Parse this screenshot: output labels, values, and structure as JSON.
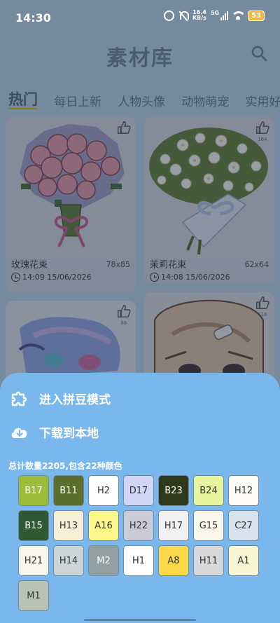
{
  "status_bar": {
    "time": "14:30",
    "network_speed_value": "16.4",
    "network_speed_unit": "KB/s",
    "network_type": "5G",
    "battery": "53",
    "icons": [
      "alarm-icon",
      "mute-icon",
      "signal-icon",
      "wifi-icon",
      "battery-icon"
    ]
  },
  "header": {
    "title": "素材库",
    "search_icon": "search-icon"
  },
  "tabs": [
    {
      "label": "热门",
      "active": true
    },
    {
      "label": "每日上新",
      "active": false
    },
    {
      "label": "人物头像",
      "active": false
    },
    {
      "label": "动物萌宠",
      "active": false
    },
    {
      "label": "实用好",
      "active": false
    }
  ],
  "cards": [
    {
      "title": "玫瑰花束",
      "size": "78x85",
      "time": "14:09 15/06/2026",
      "likes": "",
      "thumb": "pixel-rose-bouquet"
    },
    {
      "title": "茉莉花束",
      "size": "62x64",
      "time": "14:08 15/06/2026",
      "likes": "164",
      "thumb": "pixel-jasmine-bouquet"
    },
    {
      "title": "",
      "size": "",
      "time": "",
      "likes": "86",
      "thumb": "pixel-anime-portrait"
    },
    {
      "title": "",
      "size": "",
      "time": "",
      "likes": "116",
      "thumb": "pixel-girl-portrait"
    }
  ],
  "sheet": {
    "enter_bead_mode": "进入拼豆模式",
    "download_local": "下载到本地",
    "summary": "总计数量2205,包含22种颜色",
    "colors": [
      {
        "code": "B17",
        "bg": "#9dbd3a",
        "fg": "#ffffff"
      },
      {
        "code": "B11",
        "bg": "#5b6e2b",
        "fg": "#ffffff"
      },
      {
        "code": "H2",
        "bg": "#ffffff",
        "fg": "#333333"
      },
      {
        "code": "D17",
        "bg": "#d2d6f4",
        "fg": "#333333"
      },
      {
        "code": "B23",
        "bg": "#2f3a1c",
        "fg": "#ffffff"
      },
      {
        "code": "B24",
        "bg": "#e8f59e",
        "fg": "#333333"
      },
      {
        "code": "H12",
        "bg": "#fcfbf6",
        "fg": "#333333"
      },
      {
        "code": "B15",
        "bg": "#2e5a33",
        "fg": "#ffffff"
      },
      {
        "code": "H13",
        "bg": "#f6efd6",
        "fg": "#333333"
      },
      {
        "code": "A16",
        "bg": "#fbf78a",
        "fg": "#333333"
      },
      {
        "code": "H22",
        "bg": "#cbcbd8",
        "fg": "#333333"
      },
      {
        "code": "H17",
        "bg": "#f1f1f1",
        "fg": "#333333"
      },
      {
        "code": "G15",
        "bg": "#f8f7e9",
        "fg": "#333333"
      },
      {
        "code": "C27",
        "bg": "#d6e2ee",
        "fg": "#333333"
      },
      {
        "code": "H21",
        "bg": "#f8f7ec",
        "fg": "#333333"
      },
      {
        "code": "H14",
        "bg": "#ccd5d6",
        "fg": "#333333"
      },
      {
        "code": "M2",
        "bg": "#93a0a1",
        "fg": "#ffffff"
      },
      {
        "code": "H1",
        "bg": "#ffffff",
        "fg": "#333333"
      },
      {
        "code": "A8",
        "bg": "#fbd948",
        "fg": "#333333"
      },
      {
        "code": "H11",
        "bg": "#d8d8d8",
        "fg": "#333333"
      },
      {
        "code": "A1",
        "bg": "#f9f6d4",
        "fg": "#333333"
      },
      {
        "code": "M1",
        "bg": "#b9c2b6",
        "fg": "#333333"
      }
    ]
  }
}
